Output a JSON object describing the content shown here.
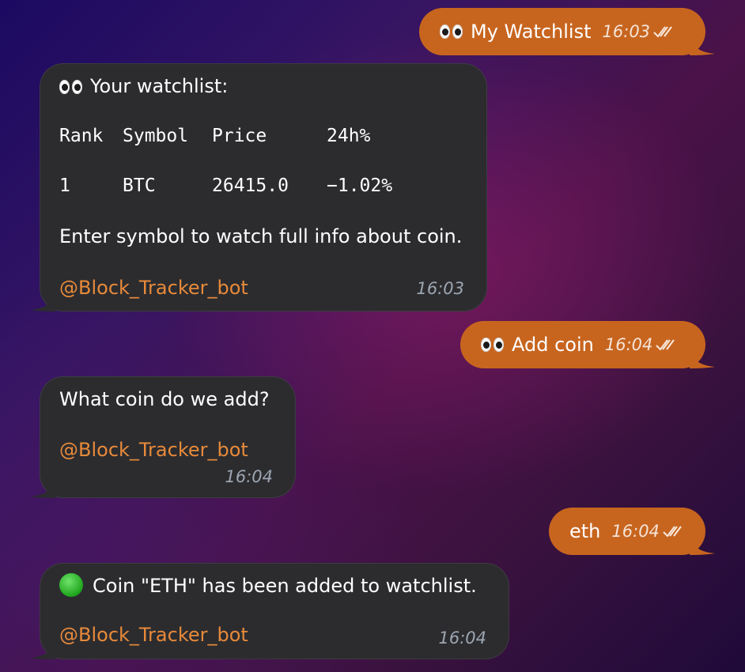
{
  "messages": {
    "out1": {
      "text": "My Watchlist",
      "time": "16:03"
    },
    "in1": {
      "title": "Your watchlist:",
      "table_header": [
        "Rank",
        "Symbol",
        "Price",
        "24h%"
      ],
      "table_row": [
        "1",
        "BTC",
        "26415.0",
        "−1.02%"
      ],
      "note": "Enter symbol to watch full info about coin.",
      "link": "@Block_Tracker_bot",
      "time": "16:03"
    },
    "out2": {
      "text": "Add coin",
      "time": "16:04"
    },
    "in2": {
      "text": "What coin do we add?",
      "link": "@Block_Tracker_bot",
      "time": "16:04"
    },
    "out3": {
      "text": "eth",
      "time": "16:04"
    },
    "in3": {
      "text": "Coin \"ETH\" has been added to watchlist.",
      "link": "@Block_Tracker_bot",
      "time": "16:04"
    }
  },
  "colors": {
    "outgoing_bubble": "#c7651f",
    "incoming_bubble": "#2c2c2f",
    "link": "#e88a3a"
  },
  "icons": {
    "eyes_emoji": "eyes-icon",
    "green_circle_emoji": "green-circle-icon",
    "read_status": "double-check-icon"
  }
}
